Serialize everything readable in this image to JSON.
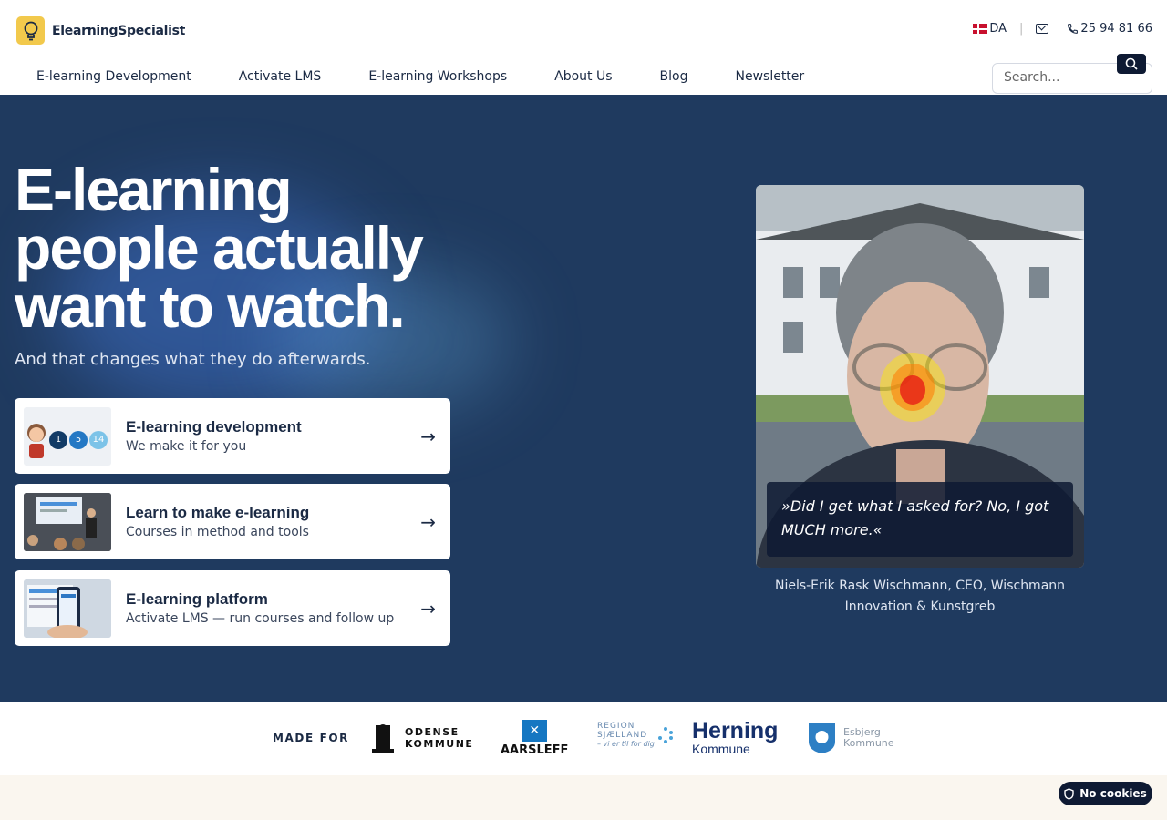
{
  "brand": {
    "name": "ElearningSpecialist"
  },
  "topbar": {
    "lang": "DA",
    "phone": "25 94 81 66"
  },
  "nav": {
    "items": [
      "E-learning Development",
      "Activate LMS",
      "E-learning Workshops",
      "About Us",
      "Blog",
      "Newsletter"
    ]
  },
  "search": {
    "placeholder": "Search..."
  },
  "hero": {
    "title_line1": "E-learning",
    "title_line2": "people actually",
    "title_line3": "want to watch.",
    "subtitle": "And that changes what they do afterwards.",
    "cards": [
      {
        "title": "E-learning development",
        "sub": "We make it for you",
        "badges": [
          "1",
          "5",
          "14"
        ]
      },
      {
        "title": "Learn to make e-learning",
        "sub": "Courses in method and tools"
      },
      {
        "title": "E-learning platform",
        "sub": "Activate LMS — run courses and follow up"
      }
    ],
    "quote": "»Did I get what I asked for? No, I got MUCH more.«",
    "caption": "Niels-Erik Rask Wischmann, CEO, Wischmann Innovation & Kunstgreb"
  },
  "clients": {
    "label": "MADE FOR",
    "odense_1": "ODENSE",
    "odense_2": "KOMMUNE",
    "aarsleff": "AARSLEFF",
    "sjaelland_1": "REGION",
    "sjaelland_2": "SJÆLLAND",
    "sjaelland_3": "– vi er til for dig",
    "herning_1": "Herning",
    "herning_2": "Kommune",
    "esbjerg_1": "Esbjerg",
    "esbjerg_2": "Kommune"
  },
  "cookie": {
    "label": "No cookies"
  },
  "colors": {
    "hero_bg": "#1f3a5f",
    "dark": "#0e1a33",
    "brand_yellow": "#f2c94c",
    "text": "#1b2a44"
  }
}
